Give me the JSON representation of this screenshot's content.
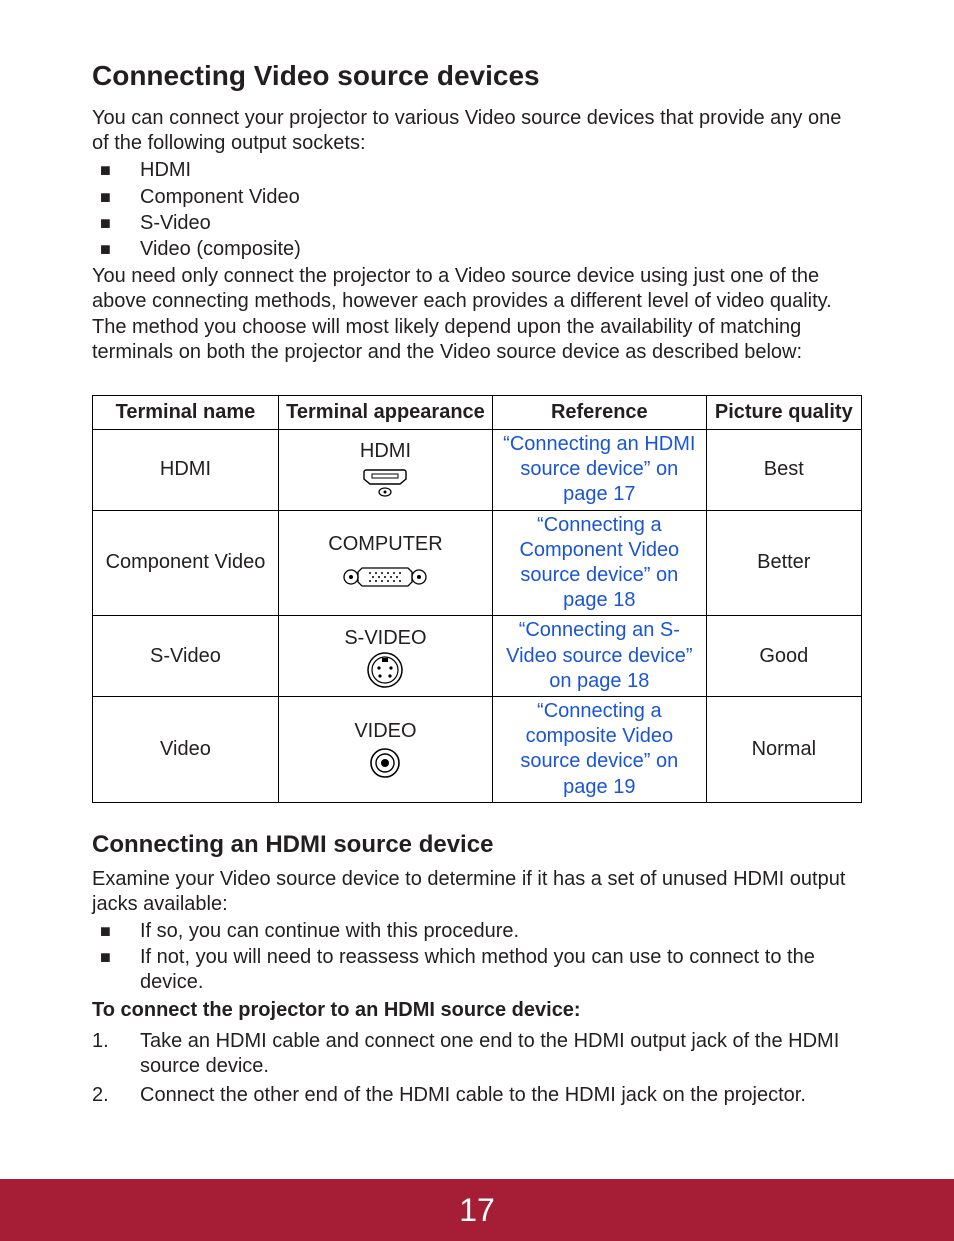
{
  "heading": "Connecting Video source devices",
  "intro": "You can connect your projector to various Video source devices that provide any one of the following output sockets:",
  "sockets": [
    "HDMI",
    "Component Video",
    "S-Video",
    "Video (composite)"
  ],
  "post_sockets": "You need only connect the projector to a Video source device using just one of the above  connecting methods, however each provides a different level of video quality. The method  you choose will most likely depend upon the availability of matching terminals on both the  projector and the Video source device as described below:",
  "table": {
    "headers": [
      "Terminal name",
      "Terminal appearance",
      "Reference",
      "Picture quality"
    ],
    "rows": [
      {
        "name": "HDMI",
        "appearance_label": "HDMI",
        "icon": "hdmi",
        "reference": "“Connecting an HDMI source device” on page 17",
        "quality": "Best"
      },
      {
        "name": "Component Video",
        "appearance_label": "COMPUTER",
        "icon": "computer",
        "reference": "“Connecting a Component Video source device” on page 18",
        "quality": "Better"
      },
      {
        "name": "S-Video",
        "appearance_label": "S-VIDEO",
        "icon": "svideo",
        "reference": "“Connecting an S-Video source device” on page 18",
        "quality": "Good"
      },
      {
        "name": "Video",
        "appearance_label": "VIDEO",
        "icon": "video",
        "reference": "“Connecting a composite Video source device” on page 19",
        "quality": "Normal"
      }
    ]
  },
  "sub_heading": "Connecting an HDMI source device",
  "sub_intro": "Examine your Video source device to determine if it has a set of unused HDMI output jacks available:",
  "sub_bullets": [
    "If so, you can continue with this procedure.",
    "If not, you will need to reassess which method you can use to connect to the device."
  ],
  "sub_bold": "To connect the projector to an HDMI source device:",
  "steps": [
    "Take an HDMI cable and connect one end to the HDMI output jack of the HDMI source device.",
    "Connect the other end of the HDMI cable to the HDMI jack on the projector."
  ],
  "page_number": "17"
}
